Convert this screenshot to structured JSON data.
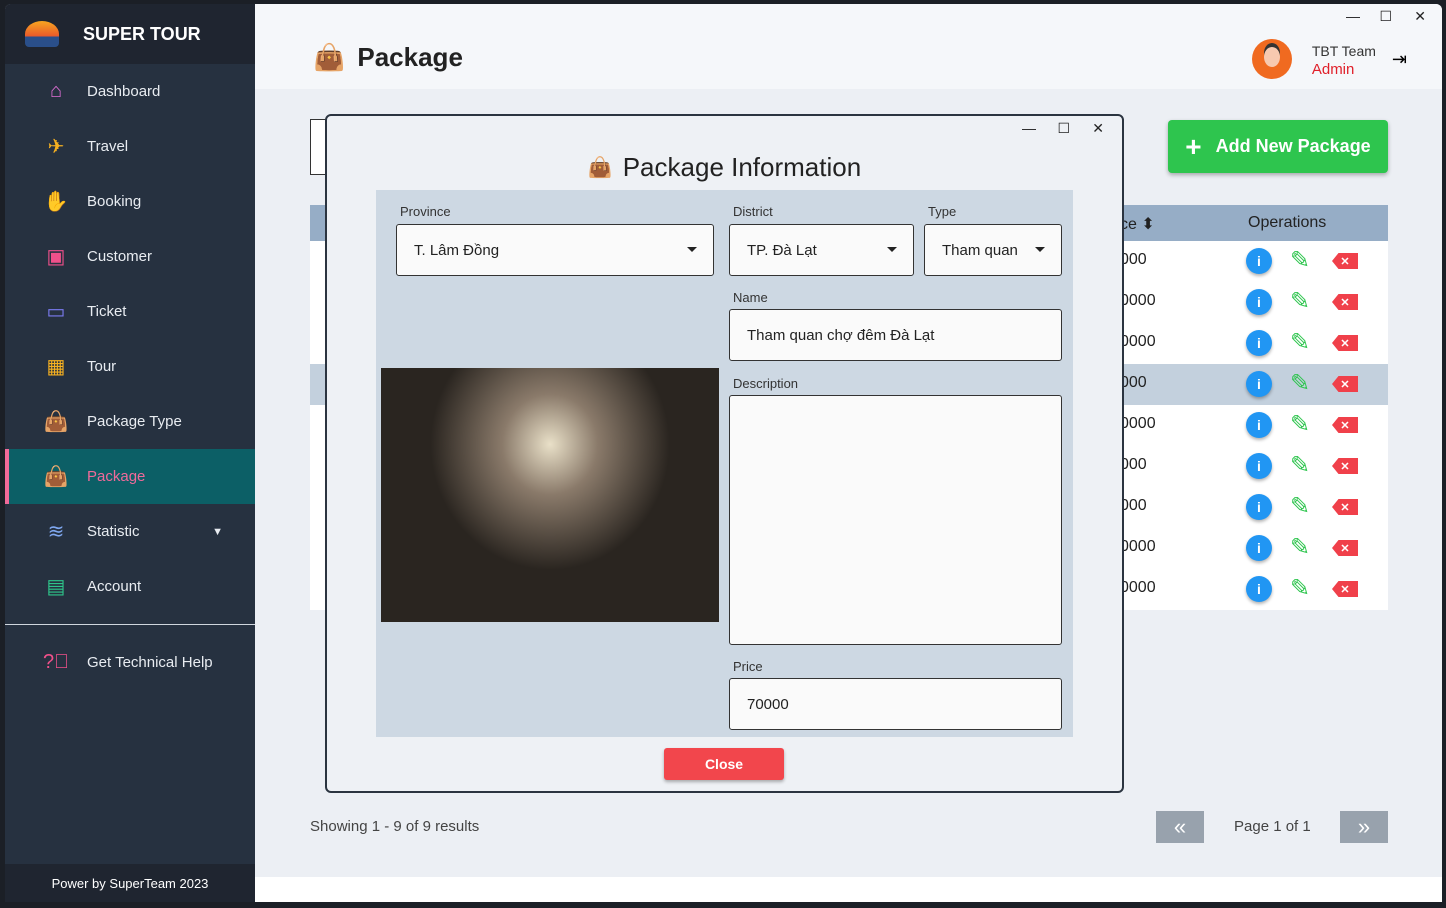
{
  "app": {
    "brand": "SUPER TOUR",
    "footer": "Power by SuperTeam 2023"
  },
  "sidebar": {
    "items": [
      {
        "label": "Dashboard",
        "icon": "home-icon",
        "color": "#e06fd6"
      },
      {
        "label": "Travel",
        "icon": "plane-icon",
        "color": "#f5b021"
      },
      {
        "label": "Booking",
        "icon": "hand-icon",
        "color": "#3fb4e8"
      },
      {
        "label": "Customer",
        "icon": "contact-icon",
        "color": "#f0508a"
      },
      {
        "label": "Ticket",
        "icon": "ticket-icon",
        "color": "#7b7bf0"
      },
      {
        "label": "Tour",
        "icon": "calendar-plus-icon",
        "color": "#f5b021"
      },
      {
        "label": "Package Type",
        "icon": "bag-icon",
        "color": "#45d3e8"
      },
      {
        "label": "Package",
        "icon": "bag-icon",
        "color": "#f06a9a"
      },
      {
        "label": "Statistic",
        "icon": "database-icon",
        "color": "#7fa8f0"
      },
      {
        "label": "Account",
        "icon": "id-card-icon",
        "color": "#2ec58a"
      }
    ],
    "help": "Get Technical Help",
    "active": "Package"
  },
  "header": {
    "title": "Package",
    "user_name": "TBT Team",
    "user_role": "Admin"
  },
  "toolbar": {
    "add_label": "Add New Package"
  },
  "table": {
    "col_price": "ce",
    "col_operations": "Operations",
    "rows": [
      "000",
      "0000",
      "0000",
      "000",
      "0000",
      "000",
      "000",
      "0000",
      "0000"
    ],
    "highlighted_row": 3
  },
  "pagination": {
    "showing": "Showing 1 - 9 of 9 results",
    "page": "Page 1 of 1",
    "prev": "«",
    "next": "»"
  },
  "modal": {
    "title": "Package Information",
    "province_label": "Province",
    "province": "T. Lâm Đồng",
    "district_label": "District",
    "district": "TP. Đà Lạt",
    "type_label": "Type",
    "type": "Tham quan",
    "name_label": "Name",
    "name": "Tham quan chợ đêm Đà Lạt",
    "description_label": "Description",
    "description": "",
    "price_label": "Price",
    "price": "70000",
    "close": "Close"
  }
}
